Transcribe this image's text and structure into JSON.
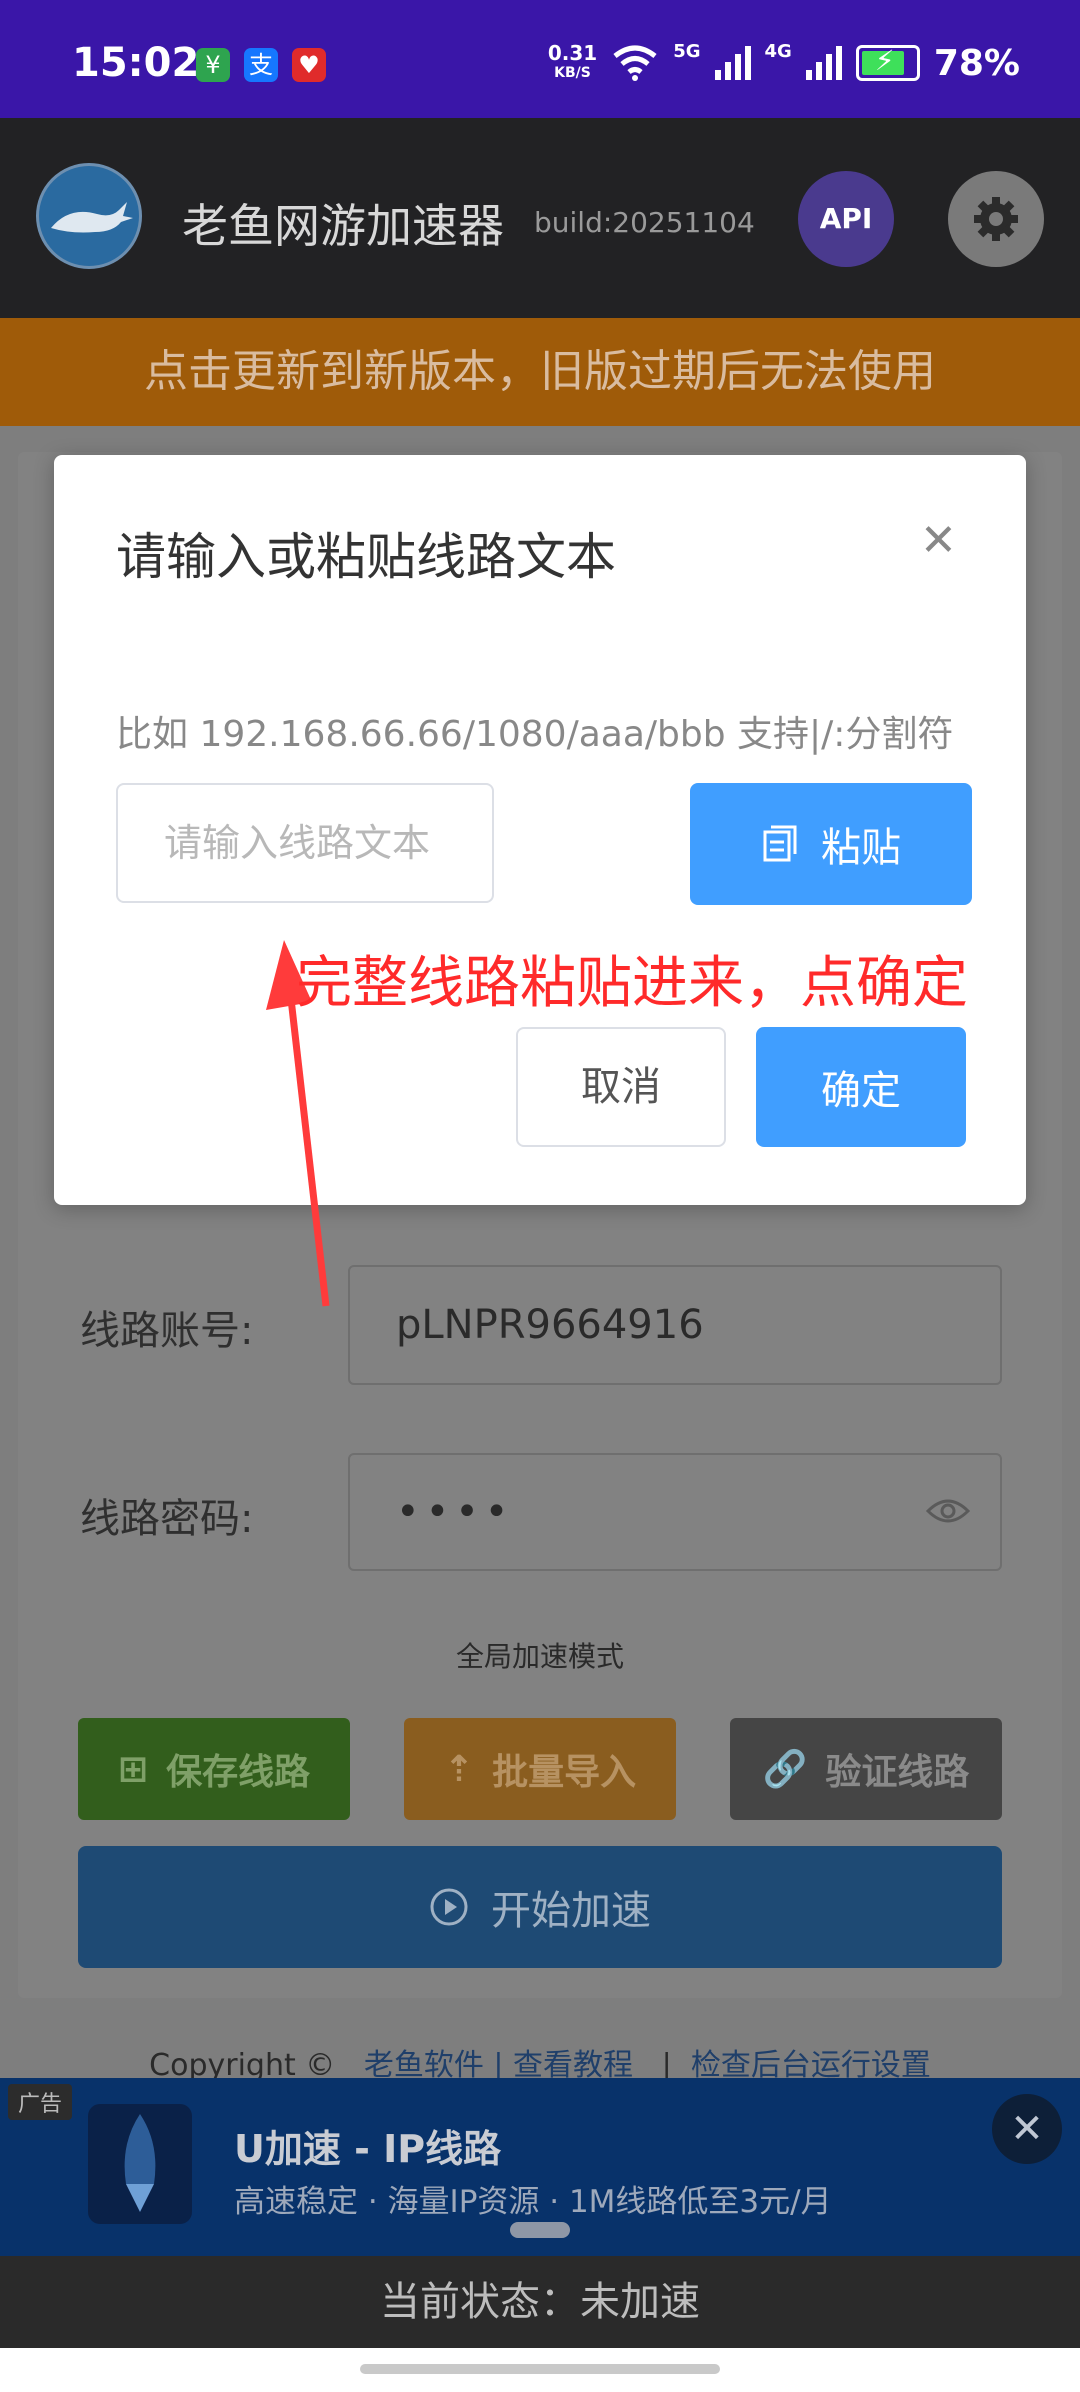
{
  "status_bar": {
    "time": "15:02",
    "speed_value": "0.31",
    "speed_unit": "KB/S",
    "net1": "5G",
    "net2": "4G",
    "battery": "78%",
    "apps": [
      "wechat-pay-icon",
      "alipay-icon",
      "app-icon"
    ]
  },
  "header": {
    "app_title": "老鱼网游加速器",
    "build": "build:20251104",
    "api_label": "API"
  },
  "update_banner": "点击更新到新版本，旧版过期后无法使用",
  "form": {
    "account_label": "线路账号:",
    "account_value": "pLNPR9664916",
    "password_label": "线路密码:",
    "password_value": "••••",
    "mode_label": "全局加速模式",
    "save_label": "保存线路",
    "import_label": "批量导入",
    "verify_label": "验证线路",
    "start_label": "开始加速"
  },
  "footer": {
    "copyright": "Copyright ©",
    "link1": "老鱼软件 | 查看教程",
    "separator": "|",
    "link2": "检查后台运行设置"
  },
  "ad": {
    "tag": "广告",
    "title": "U加速 - IP线路",
    "description": "高速稳定 · 海量IP资源 · 1M线路低至3元/月"
  },
  "current_status": "当前状态：未加速",
  "modal": {
    "title": "请输入或粘贴线路文本",
    "hint": "比如 192.168.66.66/1080/aaa/bbb 支持|/:分割符",
    "input_placeholder": "请输入线路文本",
    "paste_label": "粘贴",
    "cancel_label": "取消",
    "confirm_label": "确定"
  },
  "annotation": "完整线路粘贴进来，点确定",
  "colors": {
    "status_bar_bg": "#3a16a8",
    "primary_blue": "#409eff",
    "save_green": "#67c23a",
    "import_orange": "#e6a23c",
    "annotation_red": "#ff2a2a"
  }
}
